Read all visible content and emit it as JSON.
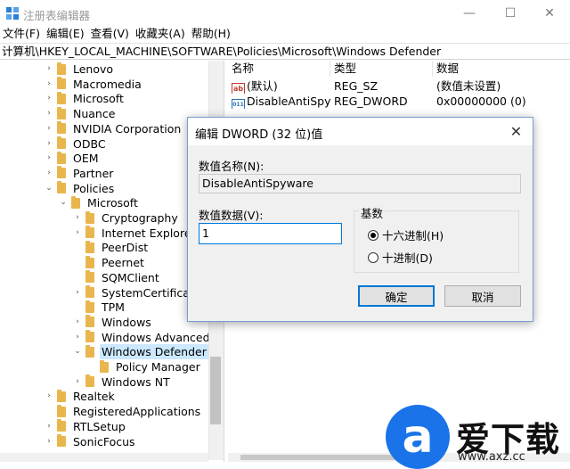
{
  "window": {
    "title": "注册表编辑器",
    "minimize_glyph": "—",
    "maximize_glyph": "☐",
    "close_glyph": "✕"
  },
  "menu": [
    "文件(F)",
    "编辑(E)",
    "查看(V)",
    "收藏夹(A)",
    "帮助(H)"
  ],
  "address": "计算机\\HKEY_LOCAL_MACHINE\\SOFTWARE\\Policies\\Microsoft\\Windows Defender",
  "tree": [
    {
      "label": "Lenovo",
      "chevron": "›"
    },
    {
      "label": "Macromedia",
      "chevron": "›"
    },
    {
      "label": "Microsoft",
      "chevron": "›"
    },
    {
      "label": "Nuance",
      "chevron": "›"
    },
    {
      "label": "NVIDIA Corporation",
      "chevron": "›"
    },
    {
      "label": "ODBC",
      "chevron": "›"
    },
    {
      "label": "OEM",
      "chevron": "›"
    },
    {
      "label": "Partner",
      "chevron": "›"
    },
    {
      "label": "Policies",
      "chevron": "⌄"
    },
    {
      "label": "Microsoft",
      "chevron": "⌄"
    },
    {
      "label": "Cryptography",
      "chevron": "›"
    },
    {
      "label": "Internet Explorer",
      "chevron": "›"
    },
    {
      "label": "PeerDist",
      "chevron": ""
    },
    {
      "label": "Peernet",
      "chevron": ""
    },
    {
      "label": "SQMClient",
      "chevron": ""
    },
    {
      "label": "SystemCertificate",
      "chevron": "›"
    },
    {
      "label": "TPM",
      "chevron": ""
    },
    {
      "label": "Windows",
      "chevron": "›"
    },
    {
      "label": "Windows Advanced T",
      "chevron": "›"
    },
    {
      "label": "Windows Defender",
      "chevron": "⌄"
    },
    {
      "label": "Policy Manager",
      "chevron": ""
    },
    {
      "label": "Windows NT",
      "chevron": "›"
    },
    {
      "label": "Realtek",
      "chevron": "›"
    },
    {
      "label": "RegisteredApplications",
      "chevron": ""
    },
    {
      "label": "RTLSetup",
      "chevron": "›"
    },
    {
      "label": "SonicFocus",
      "chevron": "›"
    }
  ],
  "list": {
    "headers": [
      "名称",
      "类型",
      "数据"
    ],
    "rows": [
      {
        "icon": "ab",
        "name": "(默认)",
        "type": "REG_SZ",
        "data": "(数值未设置)"
      },
      {
        "icon": "011",
        "name": "DisableAntiSpy...",
        "type": "REG_DWORD",
        "data": "0x00000000 (0)"
      }
    ]
  },
  "dialog": {
    "title": "编辑 DWORD (32 位)值",
    "name_label": "数值名称(N):",
    "name_value": "DisableAntiSpyware",
    "data_label": "数值数据(V):",
    "data_value": "1",
    "base_label": "基数",
    "hex_label": "十六进制(H)",
    "dec_label": "十进制(D)",
    "base_selected": "hex",
    "ok_label": "确定",
    "cancel_label": "取消",
    "close_glyph": "✕"
  },
  "watermark": {
    "logo_letter": "a",
    "title": "爱下载",
    "url": "www.axz.cc"
  },
  "colors": {
    "accent": "#0078d7",
    "selection": "#cce8ff",
    "folder": "#e8b64c",
    "watermark_blue": "#1a73e8"
  }
}
